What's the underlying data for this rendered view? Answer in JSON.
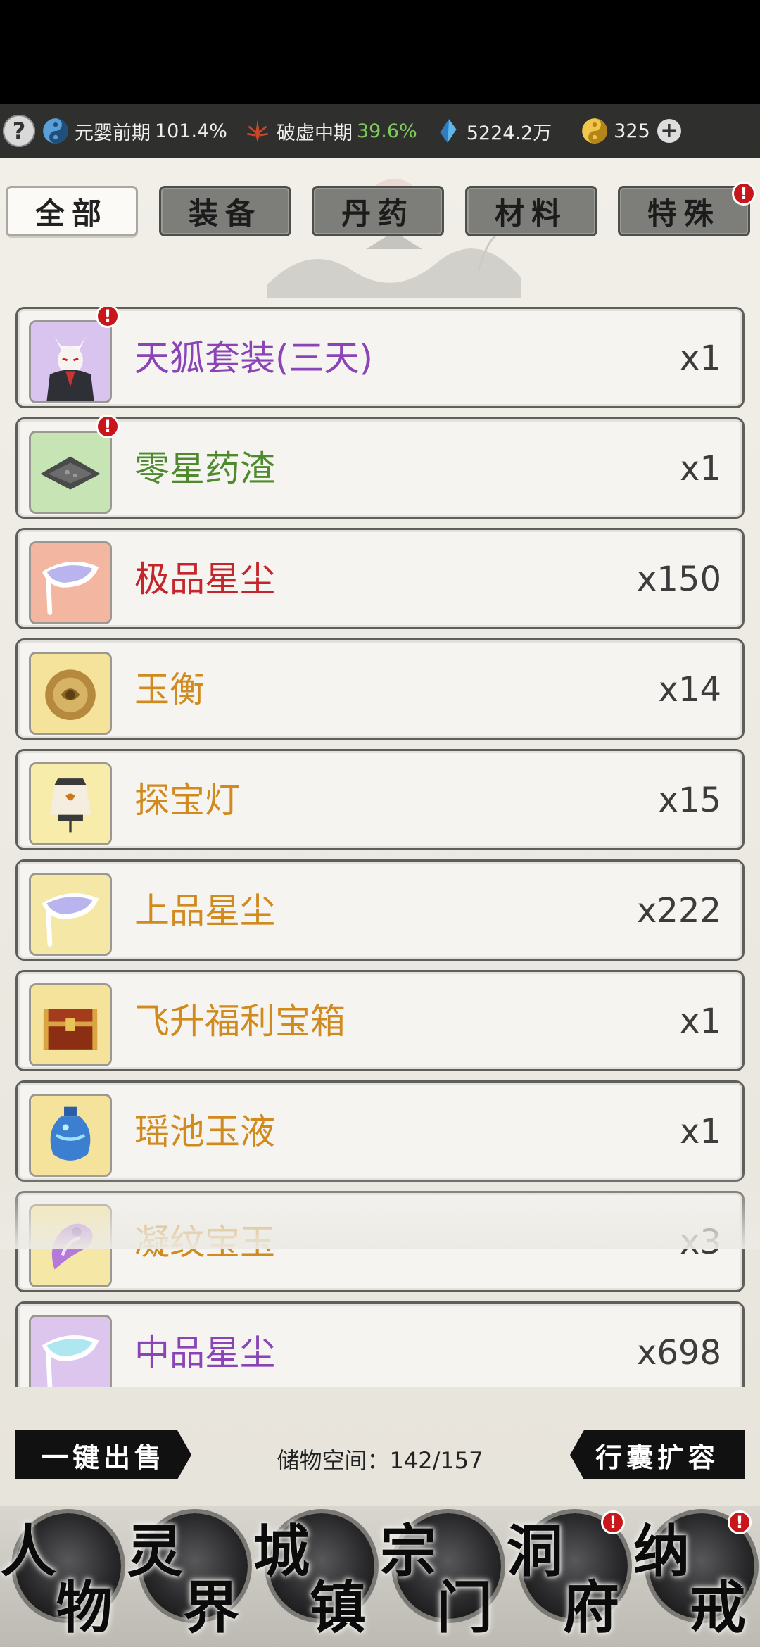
{
  "status_bar": {
    "help": "?",
    "realm1": {
      "label": "元婴前期",
      "value": "101.4%"
    },
    "realm2": {
      "label": "破虚中期",
      "value": "39.6%"
    },
    "spirit_stones": "5224.2万",
    "currency": "325",
    "plus": "+"
  },
  "tabs": [
    {
      "label": "全部",
      "active": true
    },
    {
      "label": "装备",
      "active": false
    },
    {
      "label": "丹药",
      "active": false
    },
    {
      "label": "材料",
      "active": false
    },
    {
      "label": "特殊",
      "active": false,
      "badge": "!"
    }
  ],
  "items": [
    {
      "name": "天狐套装(三天)",
      "qty": "x1",
      "name_color": "#8a44b7",
      "thumb_bg": "#d9c3ef",
      "icon": "fox-outfit-icon",
      "badge": "!"
    },
    {
      "name": "零星药渣",
      "qty": "x1",
      "name_color": "#4f8b2e",
      "thumb_bg": "#c7e4b4",
      "icon": "herb-residue-icon",
      "badge": "!"
    },
    {
      "name": "极品星尘",
      "qty": "x150",
      "name_color": "#c4262b",
      "thumb_bg": "#f3b6a1",
      "icon": "stardust-icon"
    },
    {
      "name": "玉衡",
      "qty": "x14",
      "name_color": "#d18a1e",
      "thumb_bg": "#f5e39b",
      "icon": "jade-disc-icon"
    },
    {
      "name": "探宝灯",
      "qty": "x15",
      "name_color": "#d18a1e",
      "thumb_bg": "#f7eca9",
      "icon": "treasure-lamp-icon"
    },
    {
      "name": "上品星尘",
      "qty": "x222",
      "name_color": "#d18a1e",
      "thumb_bg": "#f5e8a6",
      "icon": "stardust-icon"
    },
    {
      "name": "飞升福利宝箱",
      "qty": "x1",
      "name_color": "#d18a1e",
      "thumb_bg": "#f5e39b",
      "icon": "treasure-chest-icon"
    },
    {
      "name": "瑶池玉液",
      "qty": "x1",
      "name_color": "#d18a1e",
      "thumb_bg": "#f5e39b",
      "icon": "jade-vase-icon"
    },
    {
      "name": "凝纹宝玉",
      "qty": "x3",
      "name_color": "#d18a1e",
      "thumb_bg": "#f5e8a6",
      "icon": "jade-gem-icon"
    },
    {
      "name": "中品星尘",
      "qty": "x698",
      "name_color": "#8a44b7",
      "thumb_bg": "#dcc6ee",
      "icon": "stardust-icon"
    }
  ],
  "bottom": {
    "sell_all": "一键出售",
    "storage_label": "储物空间：",
    "storage_value": "142/157",
    "expand": "行囊扩容"
  },
  "nav": [
    {
      "c1": "人",
      "c2": "物"
    },
    {
      "c1": "灵",
      "c2": "界"
    },
    {
      "c1": "城",
      "c2": "镇"
    },
    {
      "c1": "宗",
      "c2": "门"
    },
    {
      "c1": "洞",
      "c2": "府",
      "badge": "!"
    },
    {
      "c1": "纳",
      "c2": "戒",
      "badge": "!"
    }
  ]
}
